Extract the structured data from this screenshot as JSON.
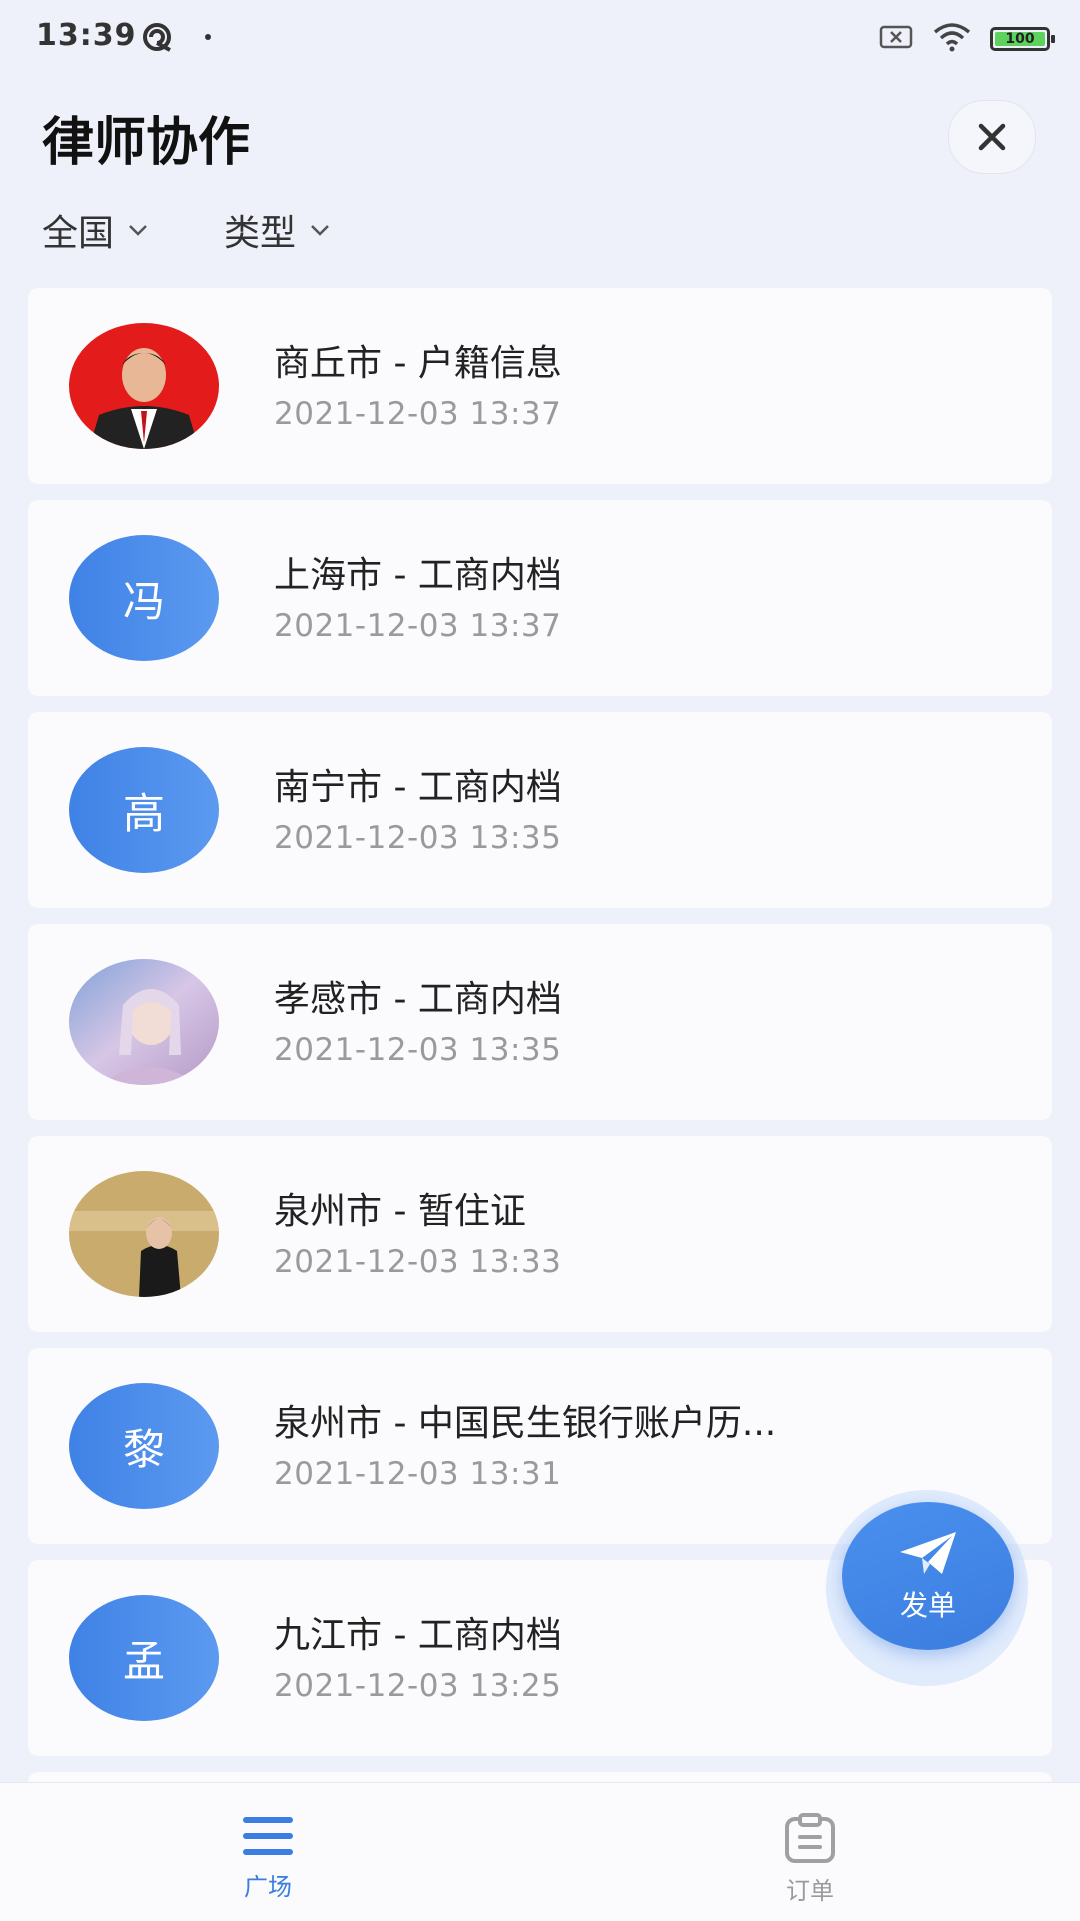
{
  "status_bar": {
    "time": "13:39",
    "battery": "100"
  },
  "header": {
    "title": "律师协作"
  },
  "filters": {
    "region": "全国",
    "type": "类型"
  },
  "orders": [
    {
      "title": "商丘市 - 户籍信息",
      "time": "2021-12-03 13:37",
      "avatar_type": "photo",
      "avatar_text": ""
    },
    {
      "title": "上海市 - 工商内档",
      "time": "2021-12-03 13:37",
      "avatar_type": "initial",
      "avatar_text": "冯"
    },
    {
      "title": "南宁市 - 工商内档",
      "time": "2021-12-03 13:35",
      "avatar_type": "initial",
      "avatar_text": "高"
    },
    {
      "title": "孝感市 - 工商内档",
      "time": "2021-12-03 13:35",
      "avatar_type": "photo",
      "avatar_text": ""
    },
    {
      "title": "泉州市 - 暂住证",
      "time": "2021-12-03 13:33",
      "avatar_type": "photo",
      "avatar_text": ""
    },
    {
      "title": "泉州市 - 中国民生银行账户历...",
      "time": "2021-12-03 13:31",
      "avatar_type": "initial",
      "avatar_text": "黎"
    },
    {
      "title": "九江市 - 工商内档",
      "time": "2021-12-03 13:25",
      "avatar_type": "initial",
      "avatar_text": "孟"
    }
  ],
  "fab": {
    "label": "发单"
  },
  "bottom_nav": {
    "home": "广场",
    "orders": "订单"
  },
  "colors": {
    "accent": "#3b7de0",
    "background": "#eef1f9",
    "card": "#fbfbfd"
  }
}
